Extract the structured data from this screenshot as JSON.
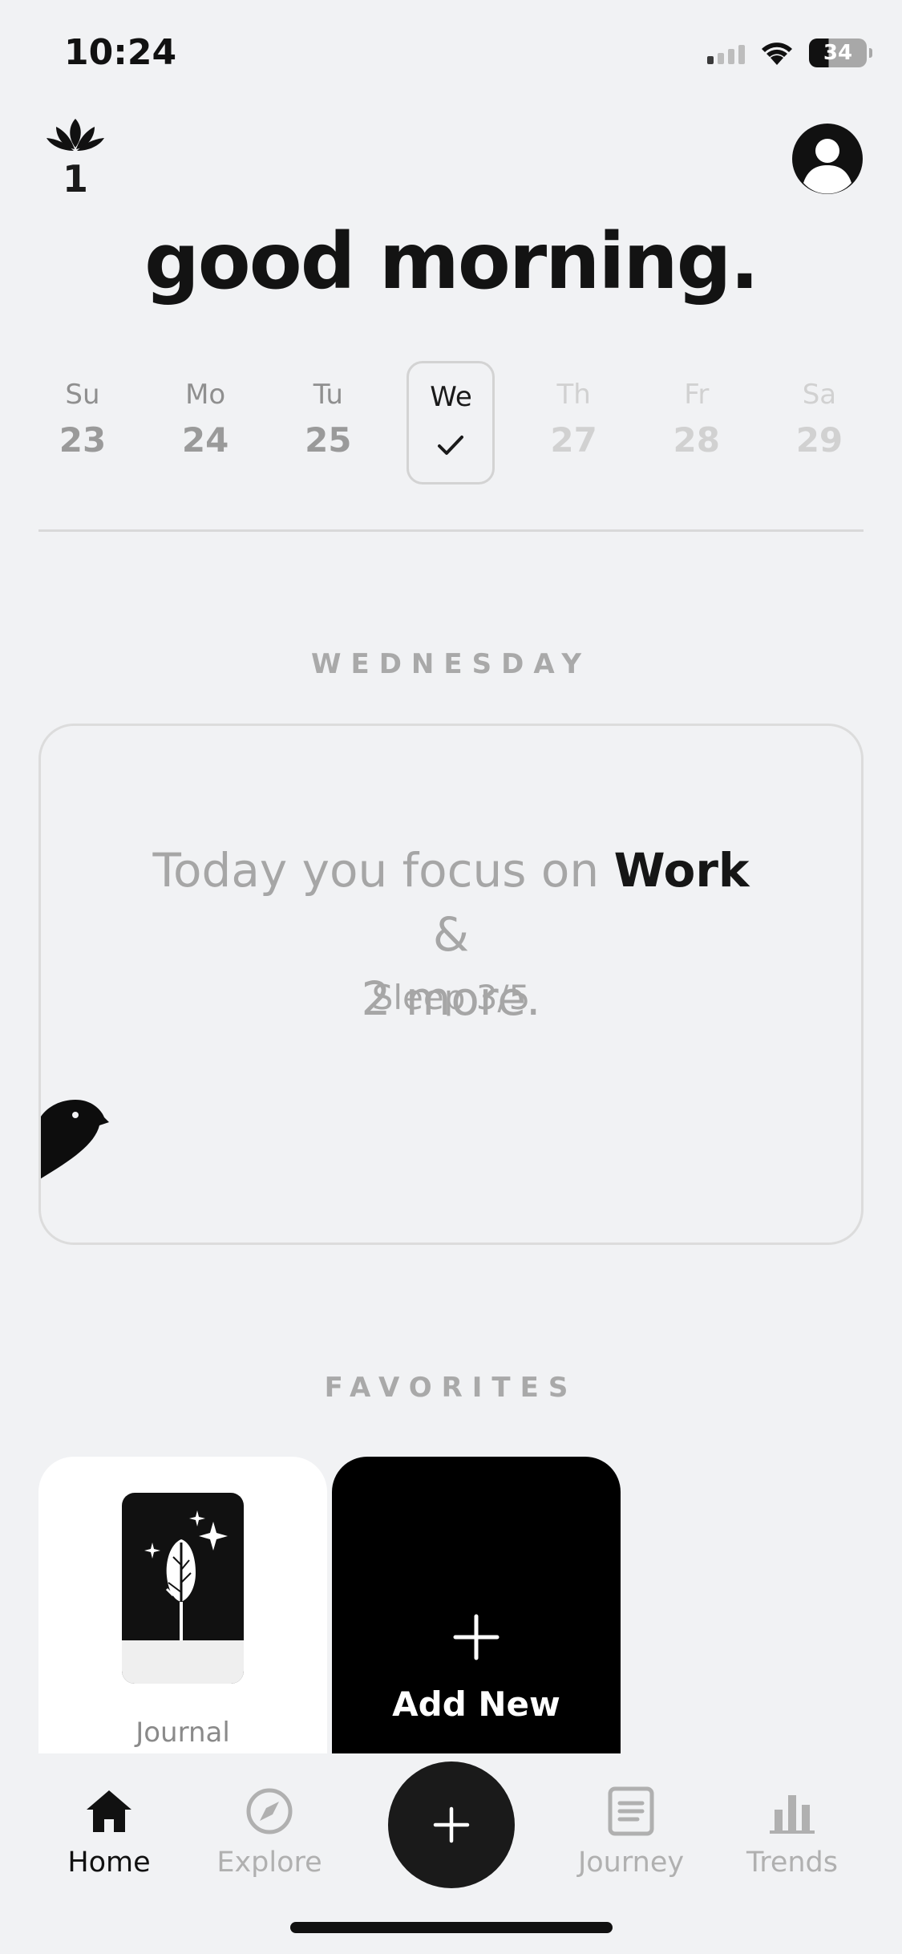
{
  "status_bar": {
    "time": "10:24",
    "battery": "34"
  },
  "header": {
    "streak_count": "1",
    "greeting": "good morning."
  },
  "week": [
    {
      "name": "Su",
      "date": "23",
      "state": "past"
    },
    {
      "name": "Mo",
      "date": "24",
      "state": "past"
    },
    {
      "name": "Tu",
      "date": "25",
      "state": "past"
    },
    {
      "name": "We",
      "date": "",
      "state": "today-checked"
    },
    {
      "name": "Th",
      "date": "27",
      "state": "future"
    },
    {
      "name": "Fr",
      "date": "28",
      "state": "future"
    },
    {
      "name": "Sa",
      "date": "29",
      "state": "future"
    }
  ],
  "day_section": {
    "label": "WEDNESDAY",
    "focus_prefix": "Today you focus on",
    "focus_highlight": "Work",
    "focus_suffix": "&",
    "focus_more": "2 more.",
    "subtitle": "Sleep 3/5"
  },
  "favorites": {
    "label": "FAVORITES",
    "items": [
      {
        "label": "Journal",
        "icon": "journal-feather-icon"
      },
      {
        "label": "Add New",
        "icon": "plus-icon"
      }
    ]
  },
  "tabs": [
    {
      "label": "Home",
      "icon": "home-icon",
      "active": true
    },
    {
      "label": "Explore",
      "icon": "compass-icon",
      "active": false
    },
    {
      "label": "Journey",
      "icon": "journal-list-icon",
      "active": false
    },
    {
      "label": "Trends",
      "icon": "bar-chart-icon",
      "active": false
    }
  ],
  "colors": {
    "background": "#f1f2f4",
    "ink": "#111111",
    "muted": "#a6a6a6"
  }
}
